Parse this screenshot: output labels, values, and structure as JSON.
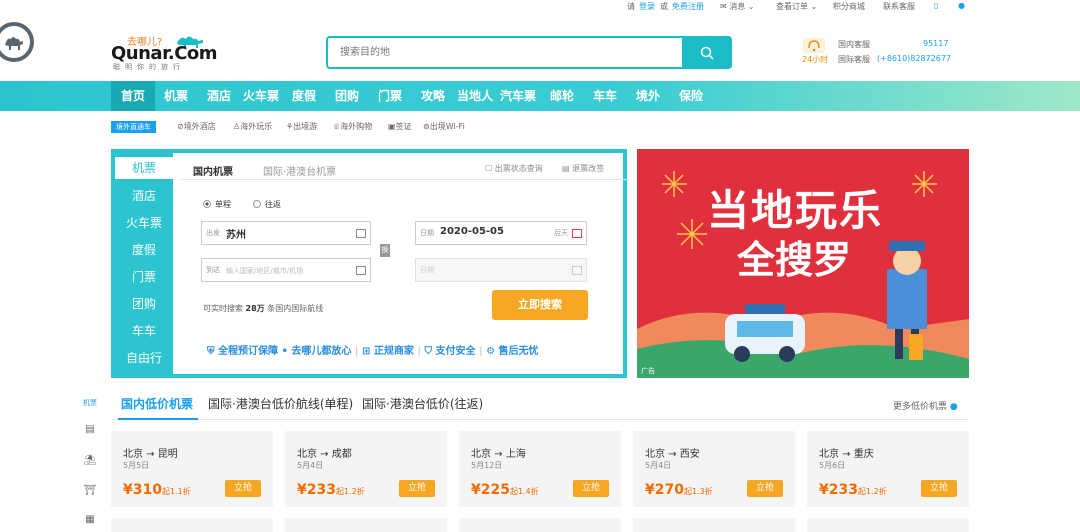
{
  "topbar": {
    "please": "请",
    "login": "登录",
    "or": "或",
    "register": "免费注册",
    "messages": "消息",
    "orders": "查看订单",
    "points_mall": "积分商城",
    "contact": "联系客服"
  },
  "logo": {
    "sub": "去哪儿?",
    "main": "Qunar.Com",
    "slogan": "聪明你的旅行"
  },
  "search": {
    "placeholder": "搜索目的地"
  },
  "service": {
    "badge": "24小时",
    "domestic_label": "国内客服",
    "domestic_num": "95117",
    "intl_label": "国际客服",
    "intl_num": "(+8610)82872677"
  },
  "nav": {
    "items": [
      "首页",
      "机票",
      "酒店",
      "火车票",
      "度假",
      "团购",
      "门票",
      "攻略",
      "当地人",
      "汽车票",
      "邮轮",
      "车车",
      "境外",
      "保险"
    ]
  },
  "subnav": {
    "tag": "境外直通车",
    "items": [
      "境外酒店",
      "海外玩乐",
      "出境游",
      "海外购物",
      "签证",
      "出境Wi-Fi"
    ]
  },
  "booking": {
    "side_items": [
      "机票",
      "酒店",
      "火车票",
      "度假",
      "门票",
      "团购",
      "车车",
      "自由行"
    ],
    "tab_domestic": "国内机票",
    "tab_intl": "国际·港澳台机票",
    "link_status": "出票状态查询",
    "link_refund": "退票改签",
    "oneway": "单程",
    "roundtrip": "往返",
    "from_label": "出发",
    "from_value": "苏州",
    "to_label": "到达",
    "to_placeholder": "输入国家/地区/城市/机场",
    "date_label": "日期",
    "date_value": "2020-05-05",
    "date_hint": "后天",
    "date2_label": "日期",
    "swap": "换",
    "count_prefix": "可实时搜索",
    "count_num": "28万",
    "count_suffix": "条国内国际航线",
    "search_btn": "立即搜索",
    "guarantee": "全程预订保障 • 去哪儿都放心",
    "g1": "正规商家",
    "g2": "支付安全",
    "g3": "售后无忧"
  },
  "banner": {
    "line1": "当地玩乐",
    "line2": "全搜罗",
    "ad": "广告"
  },
  "lowprice": {
    "side": "机票",
    "tabs": [
      "国内低价机票",
      "国际·港澳台低价航线(单程)",
      "国际·港澳台低价(往返)"
    ],
    "more": "更多低价机票",
    "cards": [
      {
        "from": "北京",
        "to": "昆明",
        "date": "5月5日",
        "price": "¥310",
        "disc": "起1.1折",
        "btn": "立抢"
      },
      {
        "from": "北京",
        "to": "成都",
        "date": "5月4日",
        "price": "¥233",
        "disc": "起1.2折",
        "btn": "立抢"
      },
      {
        "from": "北京",
        "to": "上海",
        "date": "5月12日",
        "price": "¥225",
        "disc": "起1.4折",
        "btn": "立抢"
      },
      {
        "from": "北京",
        "to": "西安",
        "date": "5月4日",
        "price": "¥270",
        "disc": "起1.3折",
        "btn": "立抢"
      },
      {
        "from": "北京",
        "to": "重庆",
        "date": "5月6日",
        "price": "¥233",
        "disc": "起1.2折",
        "btn": "立抢"
      }
    ]
  },
  "colors": {
    "brand": "#2cc5cf",
    "accent": "#f5a623",
    "link": "#19a0f0",
    "price": "#f36b00",
    "banner": "#e0303e"
  }
}
